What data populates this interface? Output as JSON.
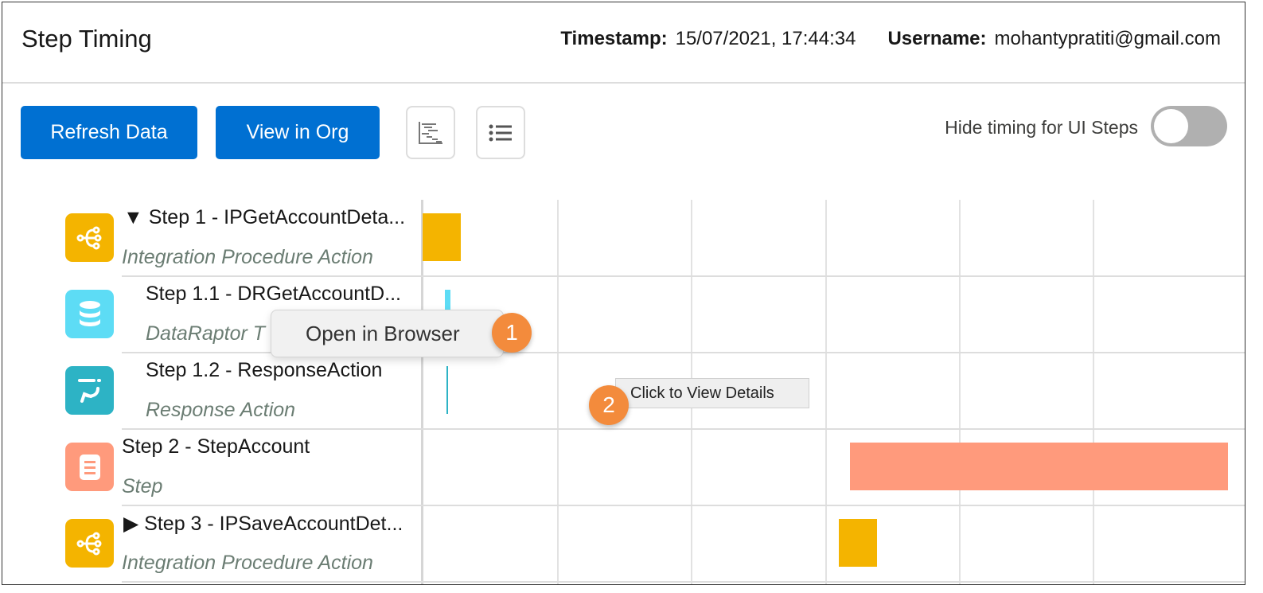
{
  "header": {
    "title": "Step Timing",
    "timestamp_label": "Timestamp:",
    "timestamp_value": "15/07/2021, 17:44:34",
    "username_label": "Username:",
    "username_value": "mohantypratiti@gmail.com"
  },
  "toolbar": {
    "refresh_label": "Refresh Data",
    "view_org_label": "View in Org",
    "timeline_view_icon": "gantt-chart-icon",
    "list_view_icon": "list-icon",
    "hide_ui_label": "Hide timing for UI Steps",
    "hide_ui_on": false
  },
  "steps": [
    {
      "name": "▼ Step 1 - IPGetAccountDeta...",
      "type": "Integration Procedure Action",
      "icon": "integration-procedure-icon",
      "color": "#f4b400"
    },
    {
      "name": "Step 1.1 - DRGetAccountD...",
      "type": "DataRaptor T",
      "icon": "database-icon",
      "color": "#5ddcf5"
    },
    {
      "name": "Step 1.2 - ResponseAction",
      "type": "Response Action",
      "icon": "response-action-icon",
      "color": "#2db3c5"
    },
    {
      "name": "Step 2 - StepAccount",
      "type": "Step",
      "icon": "step-icon",
      "color": "#ff9a7c"
    },
    {
      "name": "▶ Step 3 - IPSaveAccountDet...",
      "type": "Integration Procedure Action",
      "icon": "integration-procedure-icon",
      "color": "#f4b400"
    }
  ],
  "context_menu": {
    "item": "Open in Browser"
  },
  "tooltip": {
    "text": "Click to View Details"
  },
  "callouts": [
    "1",
    "2"
  ]
}
